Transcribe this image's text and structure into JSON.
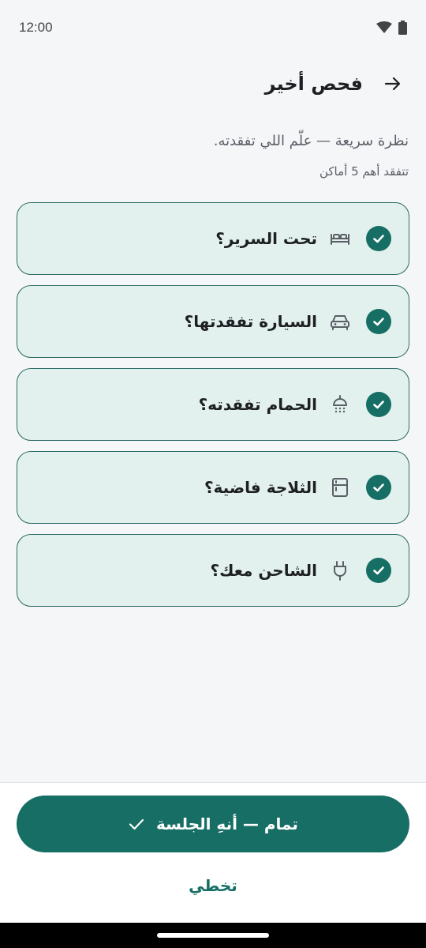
{
  "status": {
    "time": "12:00"
  },
  "header": {
    "title": "فحص أخير"
  },
  "subtitle": "نظرة سريعة — علّم اللي تفقدته.",
  "hint": "تتفقد أهم 5 أماكن",
  "items": [
    {
      "label": "تحت السرير؟",
      "icon": "bed-icon",
      "checked": true
    },
    {
      "label": "السيارة تفقدتها؟",
      "icon": "car-icon",
      "checked": true
    },
    {
      "label": "الحمام تفقدته؟",
      "icon": "shower-icon",
      "checked": true
    },
    {
      "label": "الثلاجة فاضية؟",
      "icon": "fridge-icon",
      "checked": true
    },
    {
      "label": "الشاحن معك؟",
      "icon": "plug-icon",
      "checked": true
    }
  ],
  "actions": {
    "finish_label": "تمام — أنهِ الجلسة",
    "skip_label": "تخطي"
  },
  "colors": {
    "accent": "#166e64",
    "card_bg": "#e2f1ed",
    "card_border": "#2b6b62",
    "background": "#f5f6f8"
  }
}
